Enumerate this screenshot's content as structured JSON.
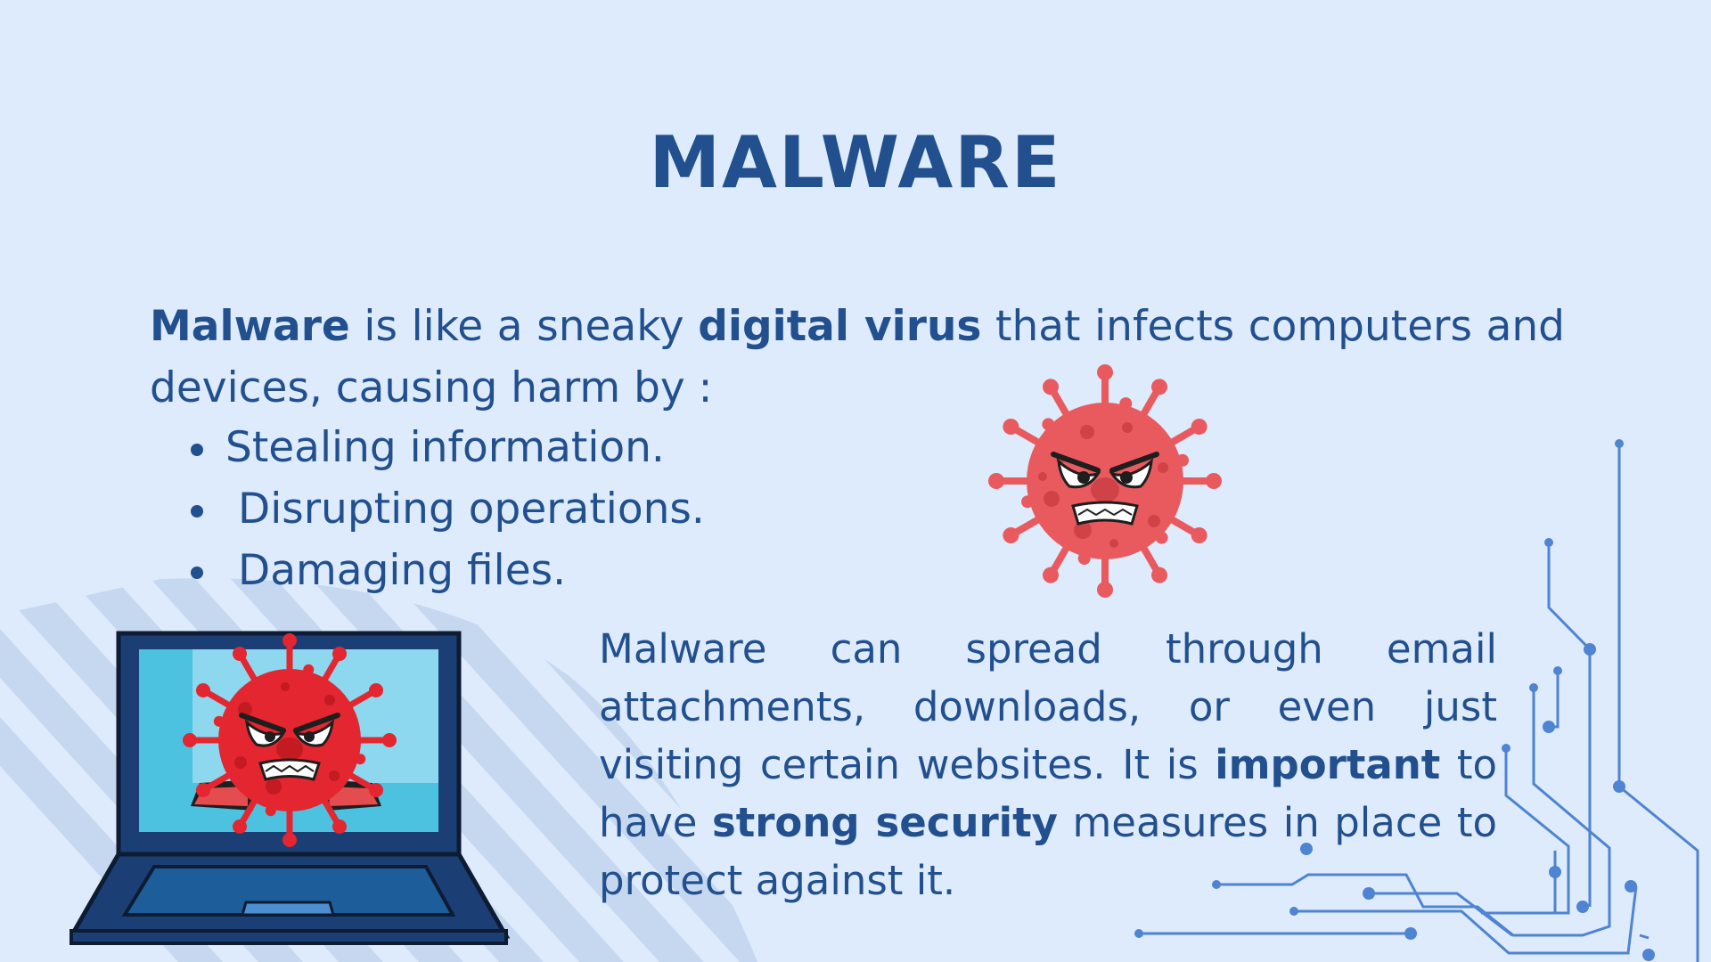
{
  "slide": {
    "title": "MALWARE",
    "intro": {
      "term": "Malware",
      "text_a": " is like a sneaky ",
      "highlight": "digital virus",
      "text_b": " that infects computers and devices, causing harm by :"
    },
    "bullets": [
      "Stealing information.",
      "Disrupting operations.",
      "Damaging files."
    ],
    "spread": {
      "text_a": "Malware can spread through email attachments, downloads, or even just visiting certain websites. It is ",
      "bold_a": "important",
      "text_b": " to have ",
      "bold_b": "strong security",
      "text_c": " measures in place to protect against it."
    }
  },
  "illustrations": {
    "large_virus": "angry-virus-icon",
    "laptop": "infected-laptop-icon",
    "circuit": "circuit-lines-decoration",
    "stripes": "diagonal-stripes-decoration"
  },
  "colors": {
    "background": "#deebfc",
    "text": "#22508f",
    "virus_red": "#e85a5e",
    "laptop_navy": "#1b3f75",
    "circuit_blue": "#4f84d2",
    "stripe": "#c6d8f0"
  }
}
